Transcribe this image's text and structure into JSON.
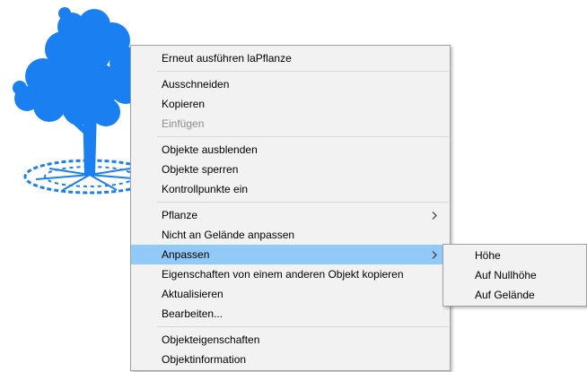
{
  "background_image": {
    "icon": "tree-icon",
    "color": "#1a7ff0"
  },
  "context_menu": {
    "groups": [
      [
        {
          "label": "Erneut ausführen laPflanze",
          "state": "normal"
        }
      ],
      [
        {
          "label": "Ausschneiden",
          "state": "normal"
        },
        {
          "label": "Kopieren",
          "state": "normal"
        },
        {
          "label": "Einfügen",
          "state": "disabled"
        }
      ],
      [
        {
          "label": "Objekte ausblenden",
          "state": "normal"
        },
        {
          "label": "Objekte sperren",
          "state": "normal"
        },
        {
          "label": "Kontrollpunkte ein",
          "state": "normal"
        }
      ],
      [
        {
          "label": "Pflanze",
          "state": "normal",
          "submenu": true
        },
        {
          "label": "Nicht an Gelände anpassen",
          "state": "normal"
        },
        {
          "label": "Anpassen",
          "state": "highlighted",
          "submenu": true
        },
        {
          "label": "Eigenschaften von einem anderen Objekt kopieren",
          "state": "normal"
        },
        {
          "label": "Aktualisieren",
          "state": "normal"
        },
        {
          "label": "Bearbeiten...",
          "state": "normal"
        }
      ],
      [
        {
          "label": "Objekteigenschaften",
          "state": "normal"
        },
        {
          "label": "Objektinformation",
          "state": "normal"
        }
      ]
    ],
    "highlight_color": "#91c9f7",
    "background_color": "#f2f2f2"
  },
  "submenu": {
    "items": [
      {
        "label": "Höhe"
      },
      {
        "label": "Auf Nullhöhe"
      },
      {
        "label": "Auf Gelände"
      }
    ]
  }
}
